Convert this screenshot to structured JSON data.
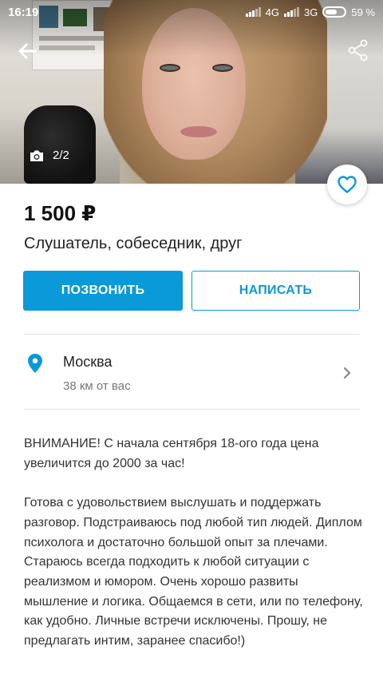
{
  "status_bar": {
    "time": "16:19",
    "network_1": "4G",
    "network_2": "3G",
    "battery": "59 %"
  },
  "gallery": {
    "counter": "2/2",
    "camera_icon": "camera-icon",
    "back_icon": "back-arrow-icon",
    "share_icon": "share-icon",
    "favorite_icon": "heart-icon"
  },
  "listing": {
    "price": "1 500 ₽",
    "title": "Слушатель, собеседник, друг"
  },
  "actions": {
    "call_label": "ПОЗВОНИТЬ",
    "write_label": "НАПИСАТЬ"
  },
  "location": {
    "city": "Москва",
    "distance": "38 км от вас"
  },
  "description": {
    "paragraph_1": "ВНИМАНИЕ! С начала сентября 18-ого года цена увеличится до 2000 за час!",
    "paragraph_2": "Готова с удовольствием выслушать и поддержать разговор. Подстраиваюсь под любой тип людей. Диплом психолога и достаточно большой опыт за плечами. Стараюсь всегда подходить к любой ситуации с реализмом и юмором. Очень хорошо развиты мышление и логика. Общаемся в сети, или по телефону, как удобно. Личные встречи исключены. Прошу, не предлагать интим, заранее спасибо!)"
  },
  "colors": {
    "accent": "#0a99d9",
    "text": "#222222",
    "secondary_text": "#777777",
    "divider": "#e2e2e2"
  }
}
